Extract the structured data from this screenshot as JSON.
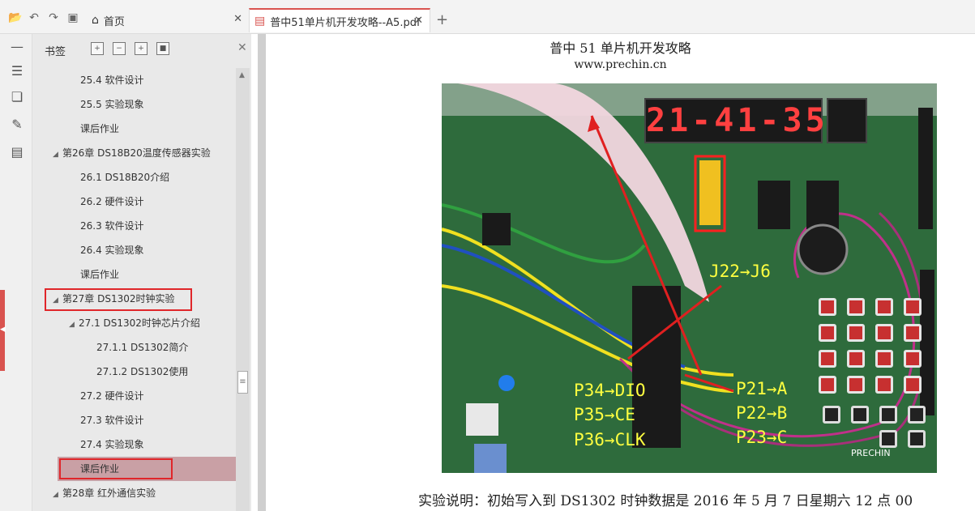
{
  "toolbar": {
    "icons": [
      "folder-open-icon",
      "undo-icon",
      "redo-icon",
      "save-icon"
    ]
  },
  "tabs": {
    "home_label": "首页",
    "pdf_label": "普中51单片机开发攻略--A5.pdf",
    "add_label": "+"
  },
  "bookmarks": {
    "title": "书签",
    "items": [
      {
        "label": "25.4 软件设计"
      },
      {
        "label": "25.5 实验现象"
      },
      {
        "label": "课后作业"
      },
      {
        "label": "第26章 DS18B20温度传感器实验"
      },
      {
        "label": "26.1 DS18B20介绍"
      },
      {
        "label": "26.2 硬件设计"
      },
      {
        "label": "26.3 软件设计"
      },
      {
        "label": "26.4 实验现象"
      },
      {
        "label": "课后作业"
      },
      {
        "label": "第27章 DS1302时钟实验"
      },
      {
        "label": "27.1 DS1302时钟芯片介绍"
      },
      {
        "label": "27.1.1 DS1302简介"
      },
      {
        "label": "27.1.2 DS1302使用"
      },
      {
        "label": "27.2 硬件设计"
      },
      {
        "label": "27.3 软件设计"
      },
      {
        "label": "27.4 实验现象"
      },
      {
        "label": "课后作业"
      },
      {
        "label": "第28章 红外通信实验"
      }
    ]
  },
  "document": {
    "title": "普中 51 单片机开发攻略",
    "url": "www.prechin.cn",
    "description": "实验说明：初始写入到 DS1302 时钟数据是 2016 年 5 月 7 日星期六 12 点 00",
    "photo": {
      "display": "21-41-35",
      "annotations": {
        "j22": "J22→J6",
        "p34": "P34→DIO",
        "p35": "P35→CE",
        "p36": "P36→CLK",
        "p21": "P21→A",
        "p22": "P22→B",
        "p23": "P23→C",
        "brand": "PRECHIN"
      }
    }
  },
  "colors": {
    "accent_red": "#e0262a",
    "selected_bg": "#c9a0a5",
    "panel_bg": "#e9e9e9",
    "annotation_yellow": "#ffff40"
  }
}
